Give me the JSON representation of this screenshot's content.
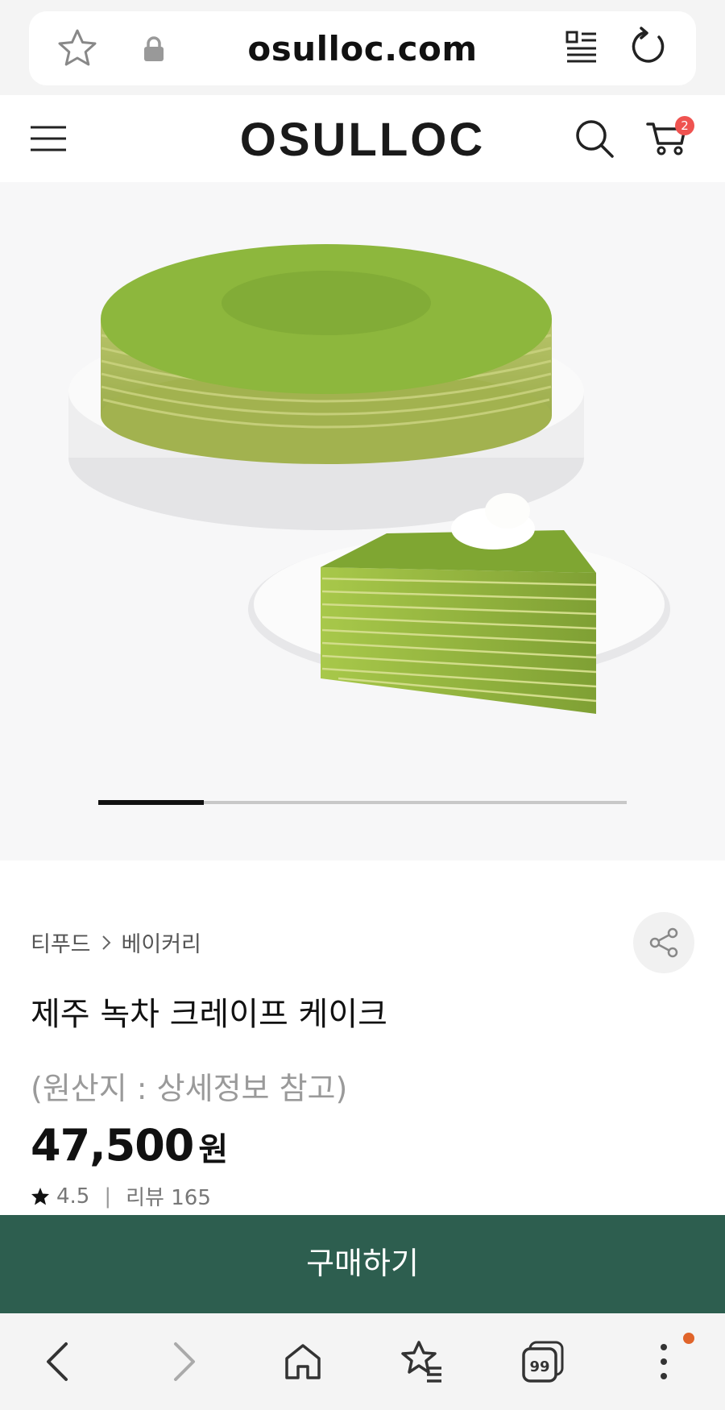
{
  "browser": {
    "url": "osulloc.com",
    "icons": [
      "star-icon",
      "lock-icon",
      "reader-mode-icon",
      "reload-icon"
    ]
  },
  "header": {
    "logo": "OSULLOC",
    "cart_count": "2",
    "icons": [
      "hamburger-menu-icon",
      "search-icon",
      "cart-icon"
    ]
  },
  "gallery": {
    "progress": 0.2
  },
  "product": {
    "breadcrumb": [
      "티푸드",
      "베이커리"
    ],
    "title": "제주 녹차 크레이프 케이크",
    "origin": "(원산지 : 상세정보 참고)",
    "price": "47,500",
    "price_unit": "원",
    "rating": "4.5",
    "rating_separator": "|",
    "review_label": "리뷰 165"
  },
  "actions": {
    "buy_label": "구매하기"
  },
  "bottom_nav": {
    "icons": [
      "back-icon",
      "forward-icon",
      "home-icon",
      "bookmarks-icon",
      "tabs-icon",
      "more-icon"
    ],
    "tabs_count": "99"
  },
  "colors": {
    "buy_button": "#2d5e4f",
    "badge": "#ef5350",
    "notification_dot": "#e0642a",
    "matcha": "#8fb53a"
  }
}
